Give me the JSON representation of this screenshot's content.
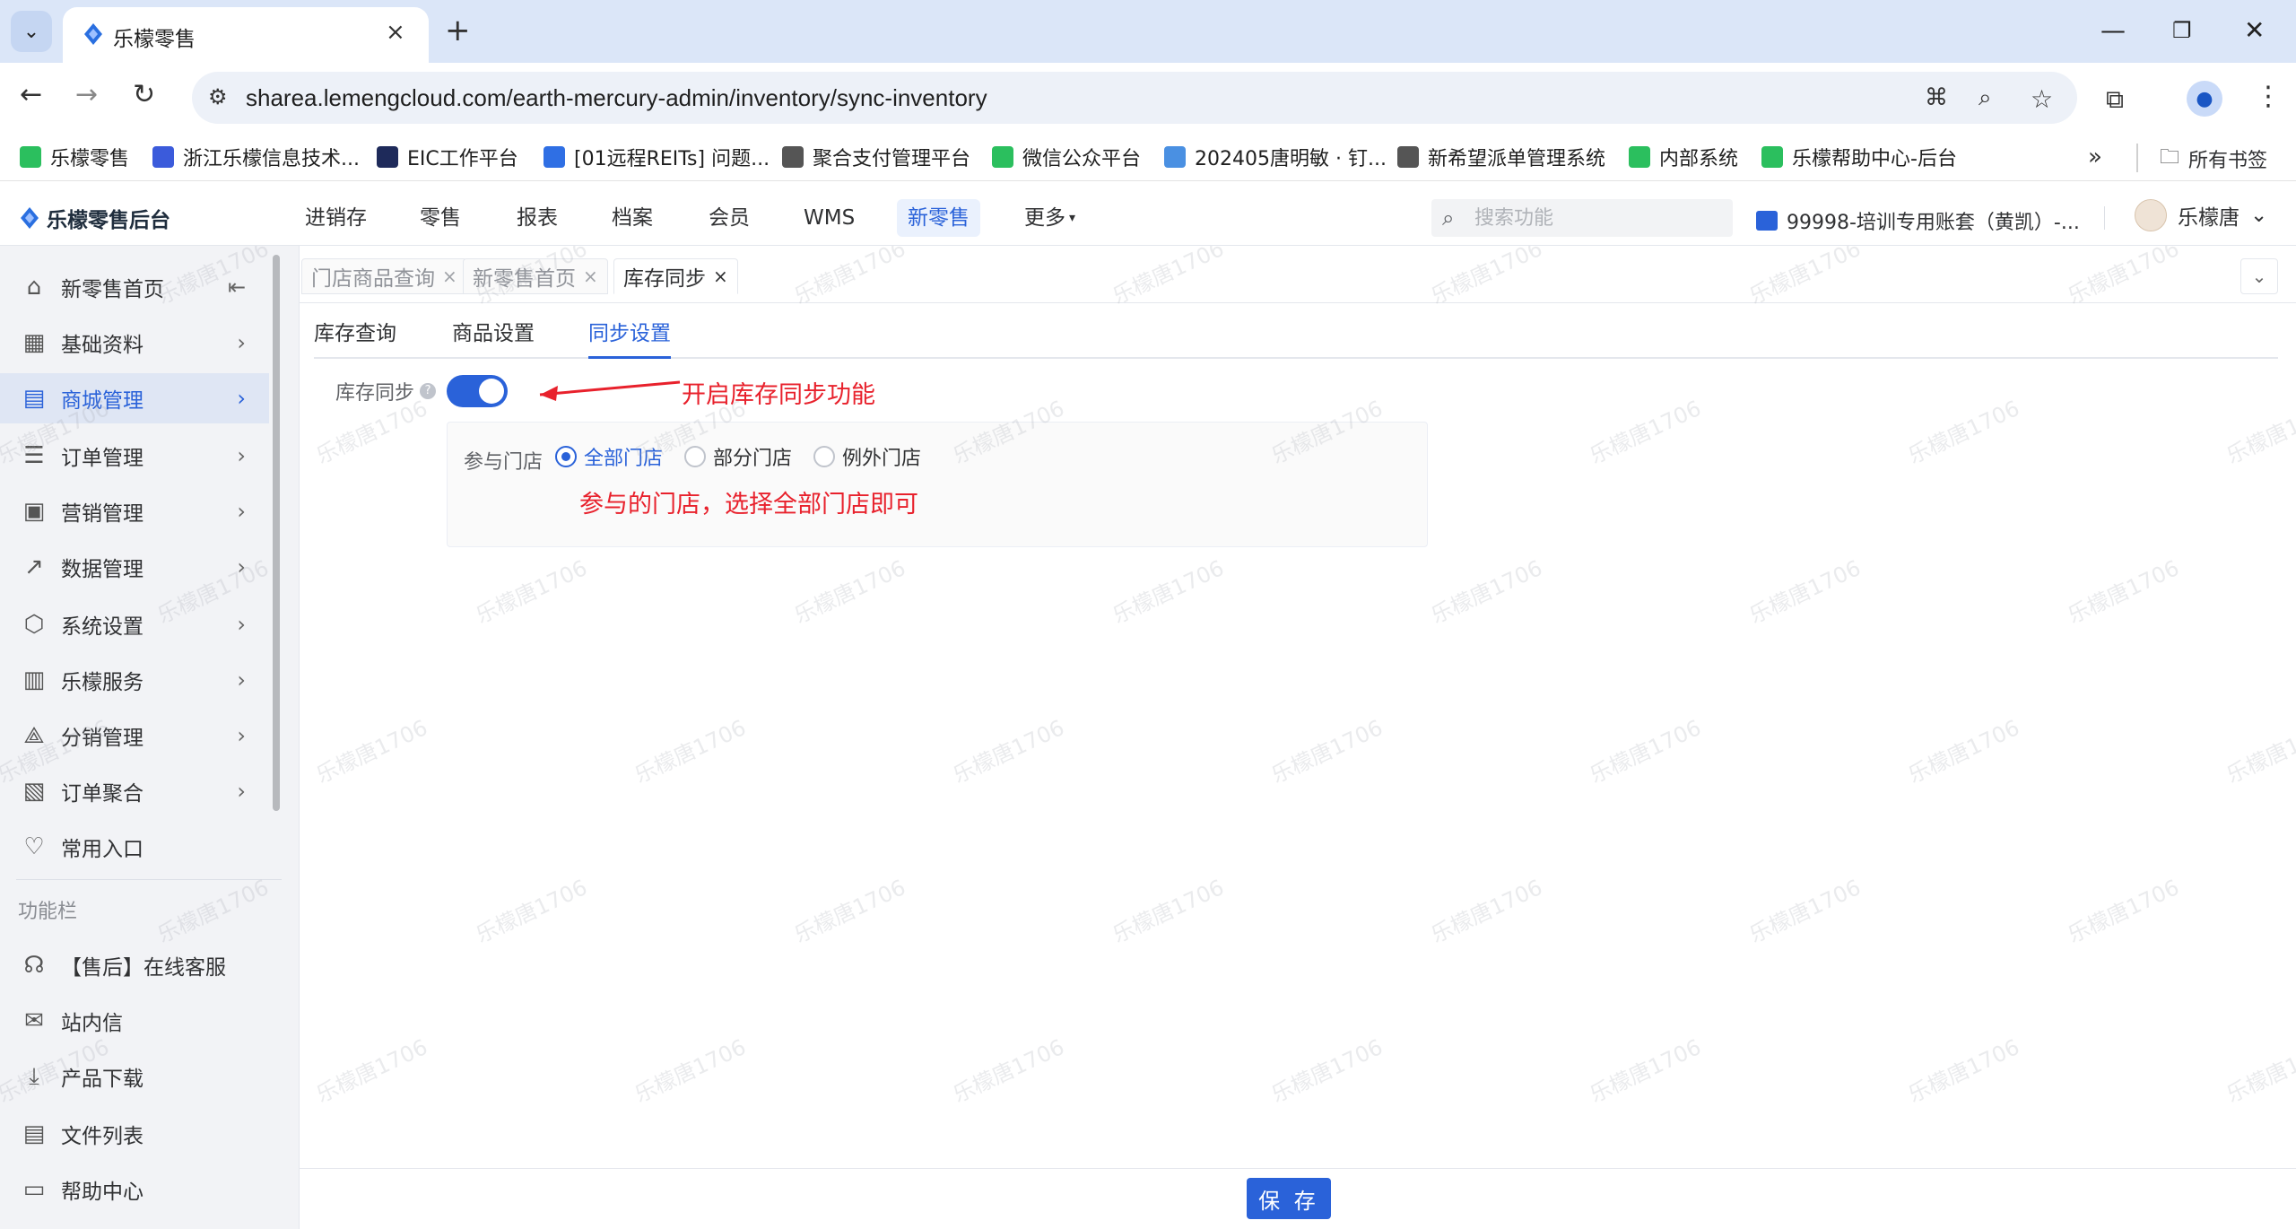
{
  "browser": {
    "tab_title": "乐檬零售",
    "tab_close": "×",
    "new_tab": "+",
    "url": "sharea.lemengcloud.com/earth-mercury-admin/inventory/sync-inventory",
    "bookmarks": [
      {
        "label": "乐檬零售",
        "color": "#2bbf5e"
      },
      {
        "label": "浙江乐檬信息技术...",
        "color": "#3b5bdb"
      },
      {
        "label": "EIC工作平台",
        "color": "#1e2a5a"
      },
      {
        "label": "[01远程REITs] 问题...",
        "color": "#2f6fe4"
      },
      {
        "label": "聚合支付管理平台",
        "color": "#555555"
      },
      {
        "label": "微信公众平台",
        "color": "#2bbf5e"
      },
      {
        "label": "202405唐明敏 · 钉...",
        "color": "#4a90e2"
      },
      {
        "label": "新希望派单管理系统",
        "color": "#555555"
      },
      {
        "label": "内部系统",
        "color": "#2bbf5e"
      },
      {
        "label": "乐檬帮助中心-后台",
        "color": "#2bbf5e"
      }
    ],
    "bookmarks_overflow": "»",
    "all_bookmarks": "所有书签"
  },
  "header": {
    "logo_text": "乐檬零售后台",
    "nav": [
      "进销存",
      "零售",
      "报表",
      "档案",
      "会员",
      "WMS",
      "新零售",
      "更多"
    ],
    "active_nav_index": 6,
    "search_placeholder": "搜索功能",
    "account": "99998-培训专用账套（黄凯）-...",
    "user_name": "乐檬唐"
  },
  "sidebar": {
    "items": [
      {
        "label": "新零售首页",
        "icon": "home-icon",
        "glyph": "⌂"
      },
      {
        "label": "基础资料",
        "icon": "grid-icon",
        "glyph": "▦"
      },
      {
        "label": "商城管理",
        "icon": "store-icon",
        "glyph": "▤"
      },
      {
        "label": "订单管理",
        "icon": "order-icon",
        "glyph": "☰"
      },
      {
        "label": "营销管理",
        "icon": "marketing-icon",
        "glyph": "▣"
      },
      {
        "label": "数据管理",
        "icon": "chart-icon",
        "glyph": "↗"
      },
      {
        "label": "系统设置",
        "icon": "settings-icon",
        "glyph": "⬡"
      },
      {
        "label": "乐檬服务",
        "icon": "service-icon",
        "glyph": "▥"
      },
      {
        "label": "分销管理",
        "icon": "distribution-icon",
        "glyph": "⟁"
      },
      {
        "label": "订单聚合",
        "icon": "aggregate-icon",
        "glyph": "▧"
      },
      {
        "label": "常用入口",
        "icon": "heart-icon",
        "glyph": "♡"
      }
    ],
    "active_index": 2,
    "section_title": "功能栏",
    "tools": [
      {
        "label": "【售后】在线客服",
        "icon": "headset-icon",
        "glyph": "☊"
      },
      {
        "label": "站内信",
        "icon": "mail-icon",
        "glyph": "✉"
      },
      {
        "label": "产品下载",
        "icon": "download-icon",
        "glyph": "⤓"
      },
      {
        "label": "文件列表",
        "icon": "file-list-icon",
        "glyph": "▤"
      },
      {
        "label": "帮助中心",
        "icon": "help-center-icon",
        "glyph": "▭"
      }
    ]
  },
  "content": {
    "page_tabs": [
      "门店商品查询",
      "新零售首页",
      "库存同步"
    ],
    "active_page_tab": 2,
    "sub_tabs": [
      "库存查询",
      "商品设置",
      "同步设置"
    ],
    "active_sub_tab": 2,
    "sync_label": "库存同步",
    "sync_enabled": true,
    "store_label": "参与门店",
    "store_options": [
      "全部门店",
      "部分门店",
      "例外门店"
    ],
    "selected_store_option": 0,
    "annotation_1": "开启库存同步功能",
    "annotation_2": "参与的门店，选择全部门店即可",
    "save_button": "保 存",
    "annotation_color": "#e8212c"
  },
  "watermark": "乐檬唐1706"
}
